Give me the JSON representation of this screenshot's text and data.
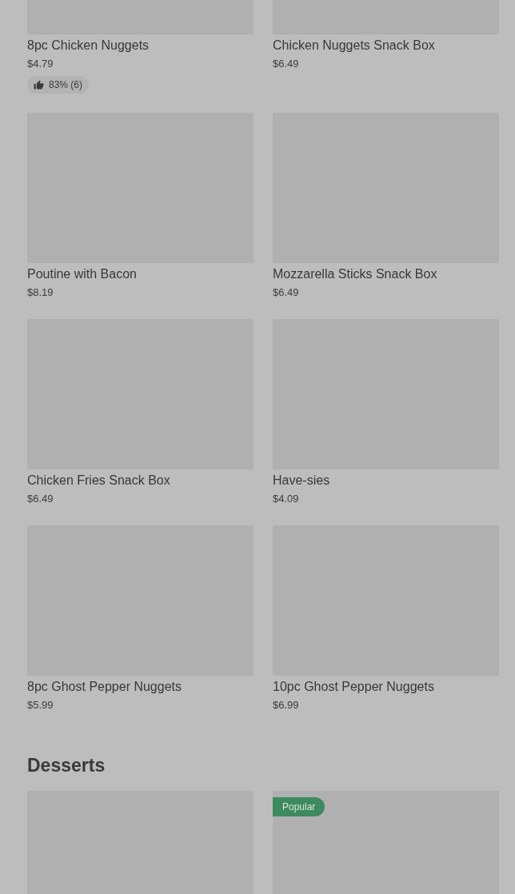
{
  "sections": [
    {
      "items": [
        {
          "kind": "product",
          "name": "8pc Chicken Nuggets",
          "price": "$4.79",
          "rating": "83% (6)"
        },
        {
          "kind": "product",
          "name": "Chicken Nuggets Snack Box",
          "price": "$6.49"
        },
        {
          "kind": "product",
          "name": "Poutine with Bacon",
          "price": "$8.19"
        },
        {
          "kind": "product",
          "name": "Mozzarella Sticks Snack Box",
          "price": "$6.49"
        },
        {
          "kind": "product",
          "name": "Chicken Fries Snack Box",
          "price": "$6.49"
        },
        {
          "kind": "product",
          "name": "Have-sies",
          "price": "$4.09"
        },
        {
          "kind": "product",
          "name": "8pc Ghost Pepper Nuggets",
          "price": "$5.99"
        },
        {
          "kind": "product",
          "name": "10pc Ghost Pepper Nuggets",
          "price": "$6.99"
        }
      ]
    },
    {
      "title": "Desserts",
      "items": [
        {
          "kind": "image"
        },
        {
          "kind": "image",
          "tag": "Popular"
        }
      ]
    }
  ]
}
